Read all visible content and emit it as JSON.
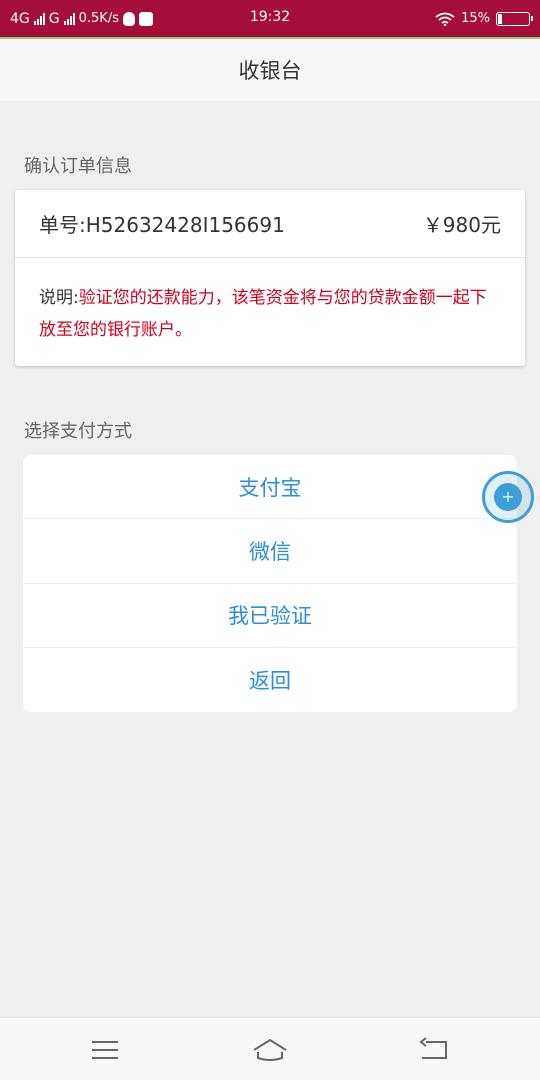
{
  "status_bar": {
    "network1": "4G",
    "network2": "G",
    "speed": "0.5K/s",
    "time": "19:32",
    "battery_percent": "15%",
    "battery_level": 0.15
  },
  "header": {
    "title": "收银台"
  },
  "order_section": {
    "label": "确认订单信息",
    "order_no": "单号:H52632428I156691",
    "amount": "￥980元",
    "desc_label": "说明:",
    "desc_text": "验证您的还款能力，该笔资金将与您的贷款金额一起下放至您的银行账户。"
  },
  "payment_section": {
    "label": "选择支付方式",
    "options": [
      "支付宝",
      "微信",
      "我已验证",
      "返回"
    ]
  },
  "floating_button": {
    "icon": "plus-icon",
    "symbol": "+"
  },
  "navigation_bar": {
    "icons": [
      "menu-icon",
      "home-icon",
      "back-icon"
    ]
  },
  "colors": {
    "status_bar": "#a50e3b",
    "accent_blue": "#2a8fd8",
    "desc_red": "#d0021b"
  }
}
